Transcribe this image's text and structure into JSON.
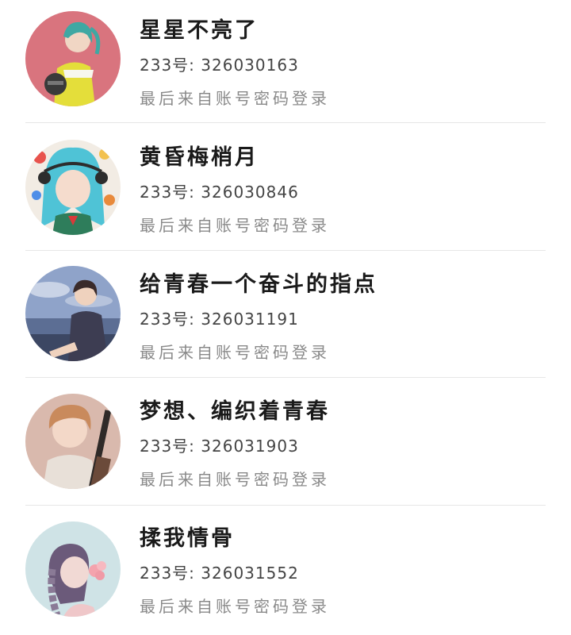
{
  "accounts": [
    {
      "nickname": "星星不亮了",
      "id_label": "233号:",
      "id_value": "326030163",
      "login_method": "最后来自账号密码登录",
      "avatar": "girl-yellow-jacket-helmet-avatar"
    },
    {
      "nickname": "黄昏梅梢月",
      "id_label": "233号:",
      "id_value": "326030846",
      "login_method": "最后来自账号密码登录",
      "avatar": "girl-teal-hair-headphones-avatar"
    },
    {
      "nickname": "给青春一个奋斗的指点",
      "id_label": "233号:",
      "id_value": "326031191",
      "login_method": "最后来自账号密码登录",
      "avatar": "boy-seaside-cloudy-sky-avatar"
    },
    {
      "nickname": "梦想、编织着青春",
      "id_label": "233号:",
      "id_value": "326031903",
      "login_method": "最后来自账号密码登录",
      "avatar": "boy-with-guitar-avatar"
    },
    {
      "nickname": "揉我情骨",
      "id_label": "233号:",
      "id_value": "326031552",
      "login_method": "最后来自账号密码登录",
      "avatar": "girl-braid-flower-avatar"
    }
  ]
}
